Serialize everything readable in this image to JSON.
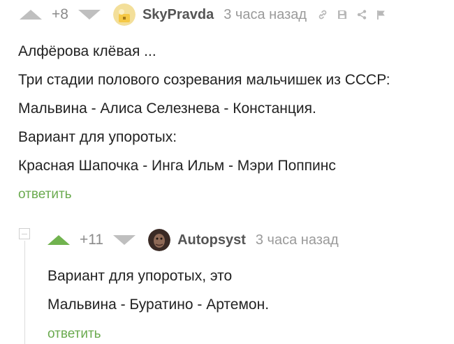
{
  "comment": {
    "rating": "+8",
    "author": "SkyPravda",
    "time": "3 часа назад",
    "lines": [
      "Алфёрова клёвая ...",
      "Три стадии полового созревания мальчишек из СССР:",
      "Мальвина - Алиса Селезнева - Констанция.",
      "Вариант для упоротых:",
      "Красная Шапочка - Инга Ильм - Мэри Поппинс"
    ],
    "reply_label": "ответить"
  },
  "reply": {
    "rating": "+11",
    "author": "Autopsyst",
    "time": "3 часа назад",
    "lines": [
      "Вариант для упоротых, это",
      "Мальвина - Буратино - Артемон."
    ],
    "reply_label": "ответить"
  },
  "colors": {
    "accent": "#6aaa4e",
    "upvote_active": "#71b34f",
    "muted": "#bfbfbf"
  },
  "icons": [
    "link-icon",
    "save-icon",
    "share-icon",
    "flag-icon"
  ]
}
